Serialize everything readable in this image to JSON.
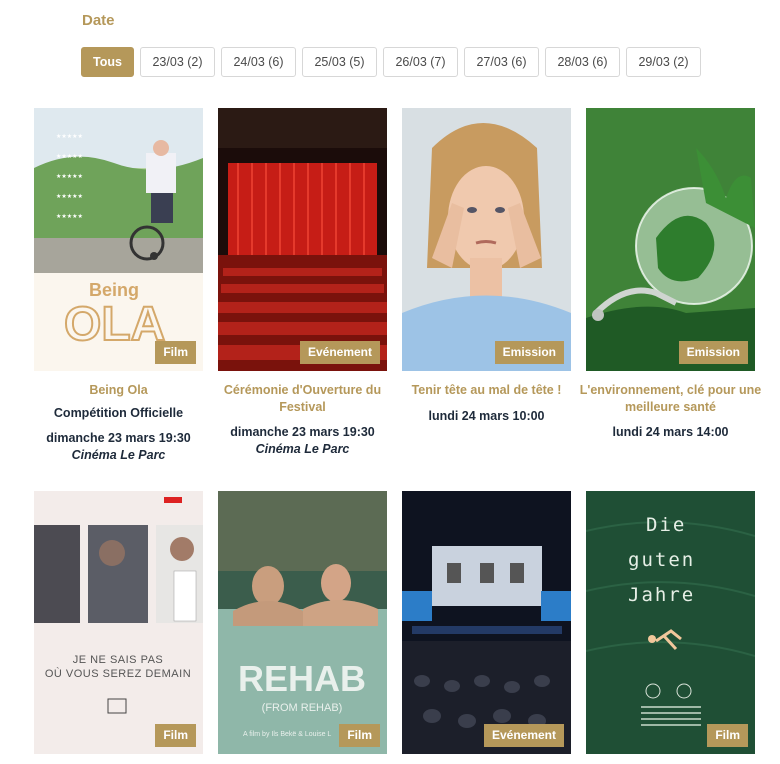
{
  "filter": {
    "title": "Date",
    "buttons": [
      "Tous",
      "23/03 (2)",
      "24/03 (6)",
      "25/03 (5)",
      "26/03 (7)",
      "27/03 (6)",
      "28/03 (6)",
      "29/03 (2)"
    ],
    "active_index": 0
  },
  "colors": {
    "accent": "#b5985a",
    "text": "#1e2a3a"
  },
  "cards": [
    {
      "badge": "Film",
      "title": "Being Ola",
      "category": "Compétition Officielle",
      "when": "dimanche 23 mars 19:30",
      "where": "Cinéma Le Parc",
      "poster_text": {
        "brand": "Being",
        "big": "OLA"
      }
    },
    {
      "badge": "Evénement",
      "title": "Cérémonie d'Ouverture du Festival",
      "category": "",
      "when": "dimanche 23 mars 19:30",
      "where": "Cinéma Le Parc"
    },
    {
      "badge": "Emission",
      "title": "Tenir tête au mal de tête !",
      "category": "",
      "when": "lundi 24 mars 10:00",
      "where": ""
    },
    {
      "badge": "Emission",
      "title": "L'environnement, clé pour une meilleure santé",
      "category": "",
      "when": "lundi 24 mars 14:00",
      "where": ""
    },
    {
      "badge": "Film",
      "title": "",
      "category": "",
      "when": "",
      "where": "",
      "poster_text": {
        "line1": "JE NE SAIS PAS",
        "line2": "OÙ VOUS SEREZ DEMAIN"
      }
    },
    {
      "badge": "Film",
      "title": "",
      "category": "",
      "when": "",
      "where": "",
      "poster_text": {
        "big": "REHAB",
        "sub": "(FROM REHAB)",
        "credit": "A film by Ils Bekë & Louise L"
      }
    },
    {
      "badge": "Evénement",
      "title": "",
      "category": "",
      "when": "",
      "where": ""
    },
    {
      "badge": "Film",
      "title": "",
      "category": "",
      "when": "",
      "where": "",
      "poster_text": {
        "line1": "Die",
        "line2": "guten",
        "line3": "Jahre"
      }
    }
  ]
}
